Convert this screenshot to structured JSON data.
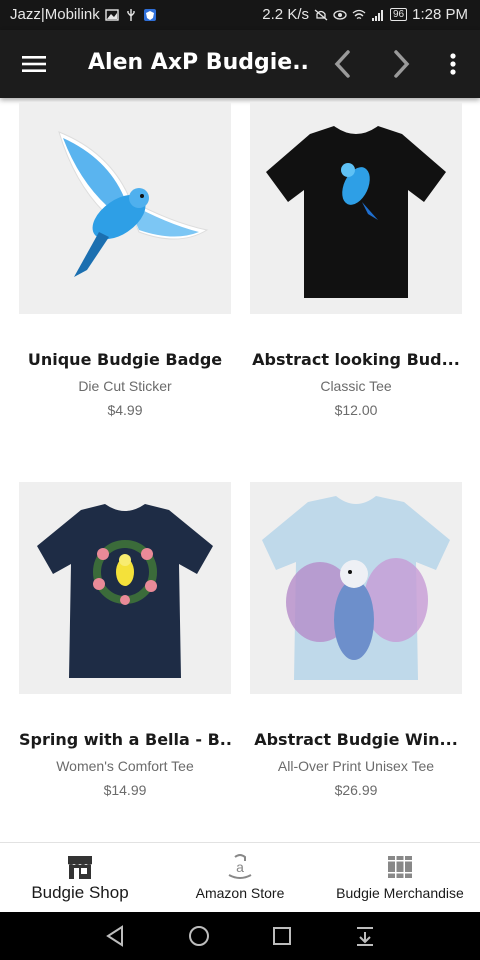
{
  "status_bar": {
    "carrier": "Jazz|Mobilink",
    "speed": "2.2 K/s",
    "signal_label": "3G",
    "battery": "96",
    "time": "1:28 PM"
  },
  "app_bar": {
    "title": "Alen AxP Budgie..."
  },
  "products": [
    {
      "title": "Unique Budgie Badge",
      "type": "Die Cut Sticker",
      "price": "$4.99"
    },
    {
      "title": "Abstract looking Bud...",
      "type": "Classic Tee",
      "price": "$12.00"
    },
    {
      "title": "Spring with a Bella - B...",
      "type": "Women's Comfort Tee",
      "price": "$14.99"
    },
    {
      "title": "Abstract Budgie Win...",
      "type": "All-Over Print Unisex Tee",
      "price": "$26.99"
    }
  ],
  "bottom_nav": {
    "items": [
      {
        "label": "Budgie Shop",
        "icon": "store-icon",
        "active": true
      },
      {
        "label": "Amazon Store",
        "icon": "amazon-icon",
        "active": false
      },
      {
        "label": "Budgie Merchandise",
        "icon": "books-icon",
        "active": false
      }
    ]
  },
  "colors": {
    "app_bar": "#1c1c1c",
    "status_bar": "#161616",
    "card_bg": "#efefef",
    "text_primary": "#1a1a1a",
    "text_secondary": "#6b6b6b",
    "budgie_blue": "#2e9fe6"
  }
}
